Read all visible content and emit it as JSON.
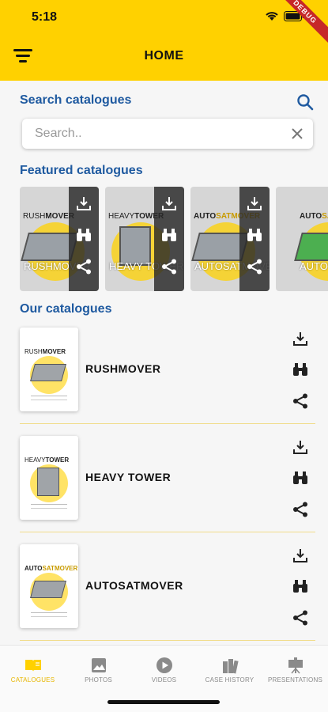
{
  "status": {
    "time": "5:18",
    "debug_banner": "DEBUG"
  },
  "header": {
    "title": "HOME"
  },
  "search": {
    "title": "Search catalogues",
    "placeholder": "Search.."
  },
  "featured": {
    "title": "Featured catalogues",
    "items": [
      {
        "name": "RUSHMOVER",
        "cover_light": "RUSH",
        "cover_bold": "MOVER"
      },
      {
        "name": "HEAVY TOWER",
        "cover_light": "HEAVY",
        "cover_bold": "TOWER"
      },
      {
        "name": "AUTOSATMOVER",
        "cover_light": "AUTO",
        "cover_bold": "SATMOVER"
      },
      {
        "name": "AUTOSA",
        "cover_light": "AUTO",
        "cover_bold": "SA"
      }
    ]
  },
  "catalogues": {
    "title": "Our catalogues",
    "items": [
      {
        "name": "RUSHMOVER",
        "cover_light": "RUSH",
        "cover_bold": "MOVER"
      },
      {
        "name": "HEAVY TOWER",
        "cover_light": "HEAVY",
        "cover_bold": "TOWER"
      },
      {
        "name": "AUTOSATMOVER",
        "cover_light": "AUTO",
        "cover_bold": "SATMOVER"
      }
    ]
  },
  "nav": {
    "tabs": [
      {
        "label": "CATALOGUES",
        "icon": "book-icon",
        "active": true
      },
      {
        "label": "PHOTOS",
        "icon": "image-icon",
        "active": false
      },
      {
        "label": "VIDEOS",
        "icon": "play-icon",
        "active": false
      },
      {
        "label": "CASE HISTORY",
        "icon": "books-icon",
        "active": false
      },
      {
        "label": "PRESENTATIONS",
        "icon": "presentation-icon",
        "active": false
      }
    ]
  },
  "colors": {
    "accent": "#ffd100",
    "heading": "#1f5aa0",
    "active_tab": "#e7b600"
  }
}
